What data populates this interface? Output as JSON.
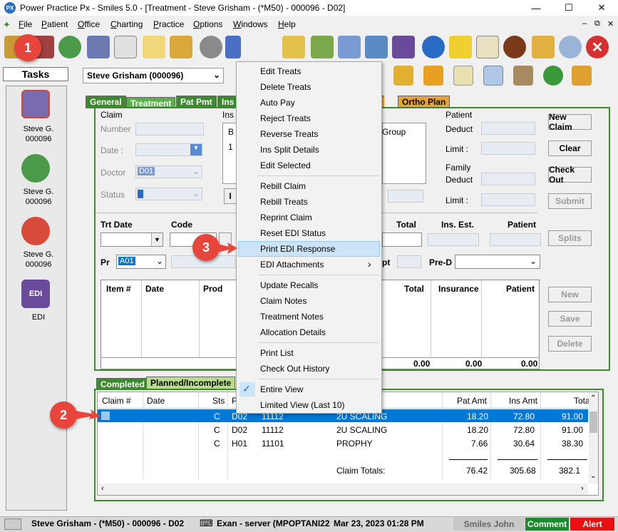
{
  "window": {
    "title": "Power Practice Px - Smiles 5.0 - [Treatment - Steve Grisham - (*M50) - 000096 - D02]",
    "app_icon": "PX"
  },
  "menu": [
    "File",
    "Patient",
    "Office",
    "Charting",
    "Practice",
    "Options",
    "Windows",
    "Help"
  ],
  "tasks": {
    "header": "Tasks",
    "items": [
      {
        "label1": "Steve G.",
        "label2": "000096",
        "icon": "book-icon"
      },
      {
        "label1": "Steve G.",
        "label2": "000096",
        "icon": "tooth-arrow-icon"
      },
      {
        "label1": "Steve G.",
        "label2": "000096",
        "icon": "people-icon"
      },
      {
        "label1": "EDI",
        "label2": "",
        "icon": "edi-icon"
      }
    ]
  },
  "patient_select": "Steve Grisham (000096)",
  "tabs": [
    "General",
    "Treatment",
    "Pat Pmt",
    "Ins",
    "nts",
    "Ortho Plan"
  ],
  "claim": {
    "section": "Claim",
    "number_label": "Number",
    "date_label": "Date :",
    "doctor_label": "Doctor",
    "doctor_value": "D01",
    "status_label": "Status",
    "ins_label": "Ins",
    "b_label": "B",
    "one_label": "1",
    "group_label": "Group"
  },
  "patient_box": {
    "section": "Patient",
    "deduct": "Deduct",
    "limit": "Limit :",
    "family": "Family",
    "family_deduct": "Deduct",
    "family_limit": "Limit :"
  },
  "buttons": {
    "new_claim": "New Claim",
    "clear": "Clear",
    "check_out": "Check Out",
    "submit": "Submit",
    "splits": "Splits",
    "new": "New",
    "save": "Save",
    "delete": "Delete"
  },
  "trt": {
    "date_label": "Trt Date",
    "code_label": "Code",
    "total_label": "Total",
    "ins_est_label": "Ins. Est.",
    "patient_label": "Patient",
    "pr_label": "Pr",
    "pr_value": "A01",
    "opt_label": "pt",
    "pred_label": "Pre-D"
  },
  "items_grid": {
    "headers": [
      "Item #",
      "Date",
      "Prod",
      "Total",
      "Insurance",
      "Patient"
    ],
    "totals": [
      "0.00",
      "0.00",
      "0.00"
    ]
  },
  "bottom_tabs": [
    "Completed",
    "Planned/Incomplete"
  ],
  "claims_grid": {
    "headers": [
      "Claim #",
      "Date",
      "Sts",
      "P",
      "Pat Amt",
      "Ins Amt",
      "Tota"
    ],
    "rows": [
      {
        "claim": "",
        "date": "",
        "sts": "C",
        "p": "D02",
        "code": "11112",
        "desc": "2U SCALING",
        "pat": "18.20",
        "ins": "72.80",
        "total": "91.00",
        "selected": true
      },
      {
        "claim": "",
        "date": "",
        "sts": "C",
        "p": "D02",
        "code": "11112",
        "desc": "2U SCALING",
        "pat": "18.20",
        "ins": "72.80",
        "total": "91.00",
        "selected": false
      },
      {
        "claim": "",
        "date": "",
        "sts": "C",
        "p": "H01",
        "code": "11101",
        "desc": "PROPHY",
        "pat": "7.66",
        "ins": "30.64",
        "total": "38.30",
        "selected": false
      }
    ],
    "totals_label": "Claim Totals:",
    "totals": {
      "pat": "76.42",
      "ins": "305.68",
      "total": "382.1"
    }
  },
  "context_menu": {
    "groups": [
      [
        "Edit Treats",
        "Delete Treats",
        "Auto Pay",
        "Reject Treats",
        "Reverse Treats",
        "Ins Split Details",
        "Edit Selected"
      ],
      [
        "Rebill Claim",
        "Rebill Treats",
        "Reprint Claim",
        "Reset EDI Status",
        "Print EDI Response",
        "EDI Attachments"
      ],
      [
        "Update Recalls",
        "Claim Notes",
        "Treatment Notes",
        "Allocation Details"
      ],
      [
        "Print List",
        "Check Out History"
      ],
      [
        "Entire View",
        "Limited View (Last 10)"
      ]
    ],
    "highlighted": "Print EDI Response",
    "checked": "Entire View",
    "submenu_arrow": "›"
  },
  "callouts": [
    "1",
    "2",
    "3"
  ],
  "status_bar": {
    "patient": "Steve Grisham - (*M50) - 000096 - D02",
    "server": "Exan - server (MPOPTANI22",
    "datetime": "Mar 23, 2023 01:28 PM",
    "user": "Smiles John",
    "comment": "Comment",
    "alert": "Alert"
  },
  "colors": {
    "tab_green": "#3c8a2e",
    "tab_orange": "#e8a23a",
    "selection": "#0078d7",
    "highlight": "#cce4f7",
    "badge": "#e7453b"
  }
}
